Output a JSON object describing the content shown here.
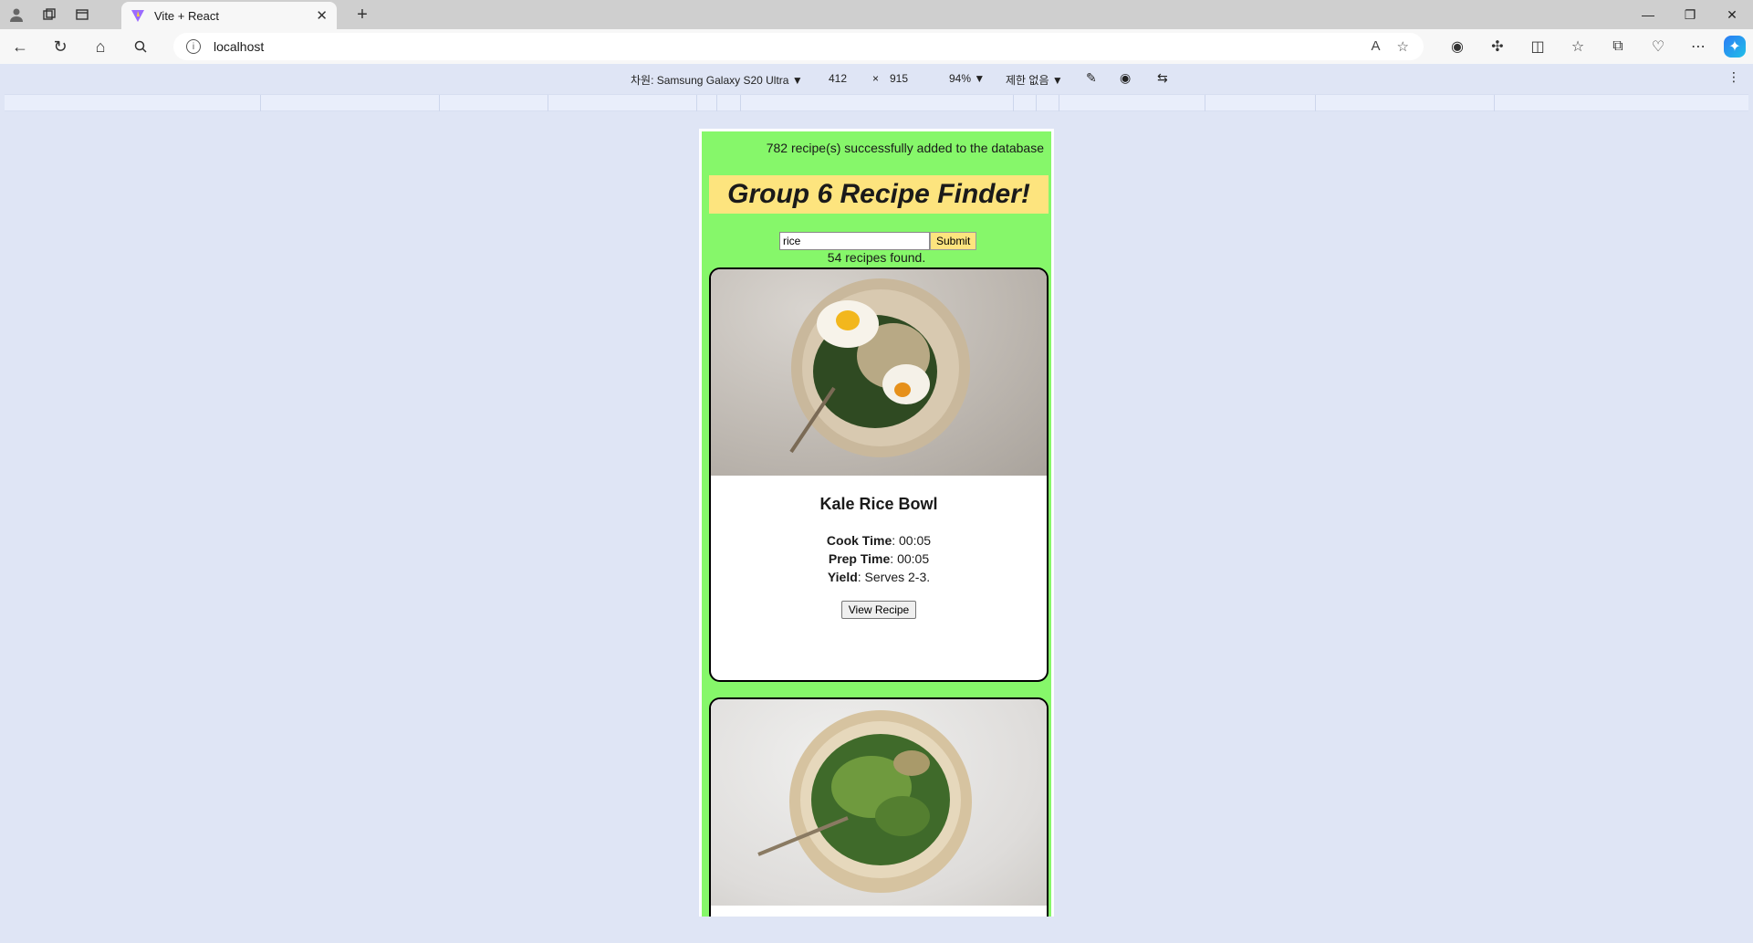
{
  "browser": {
    "tab_title": "Vite + React",
    "url": "localhost"
  },
  "device_toolbar": {
    "device": "차원: Samsung Galaxy S20 Ultra",
    "width": "412",
    "times": "×",
    "height": "915",
    "zoom": "94%",
    "throttle": "제한 없음"
  },
  "app": {
    "status_message": "782 recipe(s) successfully added to the database",
    "title": "Group 6 Recipe Finder!",
    "search_value": "rice",
    "submit_label": "Submit",
    "result_count": "54 recipes found."
  },
  "recipes": [
    {
      "name": "Kale Rice Bowl",
      "cook_label": "Cook Time",
      "cook_time": ": 00:05",
      "prep_label": "Prep Time",
      "prep_time": ": 00:05",
      "yield_label": "Yield",
      "yield": ": Serves 2-3.",
      "button": "View Recipe"
    }
  ]
}
